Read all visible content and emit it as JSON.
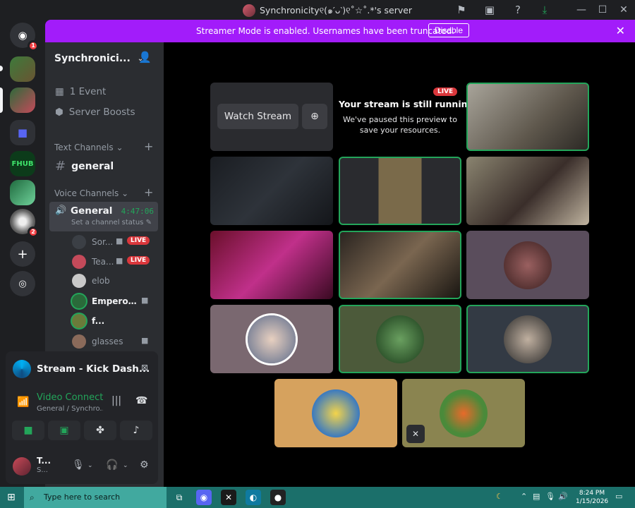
{
  "window": {
    "title": "Synchronicity୧(๑′ᴗ‵)୧˚☆˚.*'s server",
    "buttons": [
      "minimize-icon",
      "maximize-icon",
      "close-icon"
    ]
  },
  "notice": {
    "message": "Streamer Mode is enabled. Usernames have been truncated.",
    "disable_label": "Disable"
  },
  "rail": {
    "home_badge": "1",
    "server_badge": "2",
    "fhub_label": "FHUB"
  },
  "sidebar": {
    "server_name": "Synchronici...",
    "event": "1 Event",
    "boosts": "Server Boosts",
    "text_category": "Text Channels",
    "text_channel": "general",
    "voice_category": "Voice Channels",
    "voice_channel": "General",
    "voice_timer": "4:47:06",
    "voice_status": "Set a channel status",
    "members": [
      {
        "name": "Sor...",
        "live": "LIVE",
        "color": "#3b3f45"
      },
      {
        "name": "Tea...",
        "live": "LIVE",
        "color": "#c44a5a"
      },
      {
        "name": "elob",
        "live": "",
        "color": "#c9c9c9"
      },
      {
        "name": "EmperorF...",
        "live": "",
        "color": "#2a6a3a"
      },
      {
        "name": "f...",
        "live": "",
        "color": "#6a7a3a"
      },
      {
        "name": "glasses",
        "live": "",
        "color": "#8a6a5a"
      }
    ]
  },
  "panel": {
    "stream_title": "Stream - Kick Dash...",
    "vc_title": "Video Connected",
    "vc_sub": "General / Synchro...",
    "user_name": "T...",
    "user_status": "S..."
  },
  "stage": {
    "watch_stream": "Watch Stream",
    "still_title": "Your stream is still running!",
    "still_body": "We've paused this preview to save your resources.",
    "live_badge": "LIVE"
  },
  "taskbar": {
    "search_placeholder": "Type here to search",
    "time": "8:24 PM",
    "date": "1/15/2026"
  }
}
